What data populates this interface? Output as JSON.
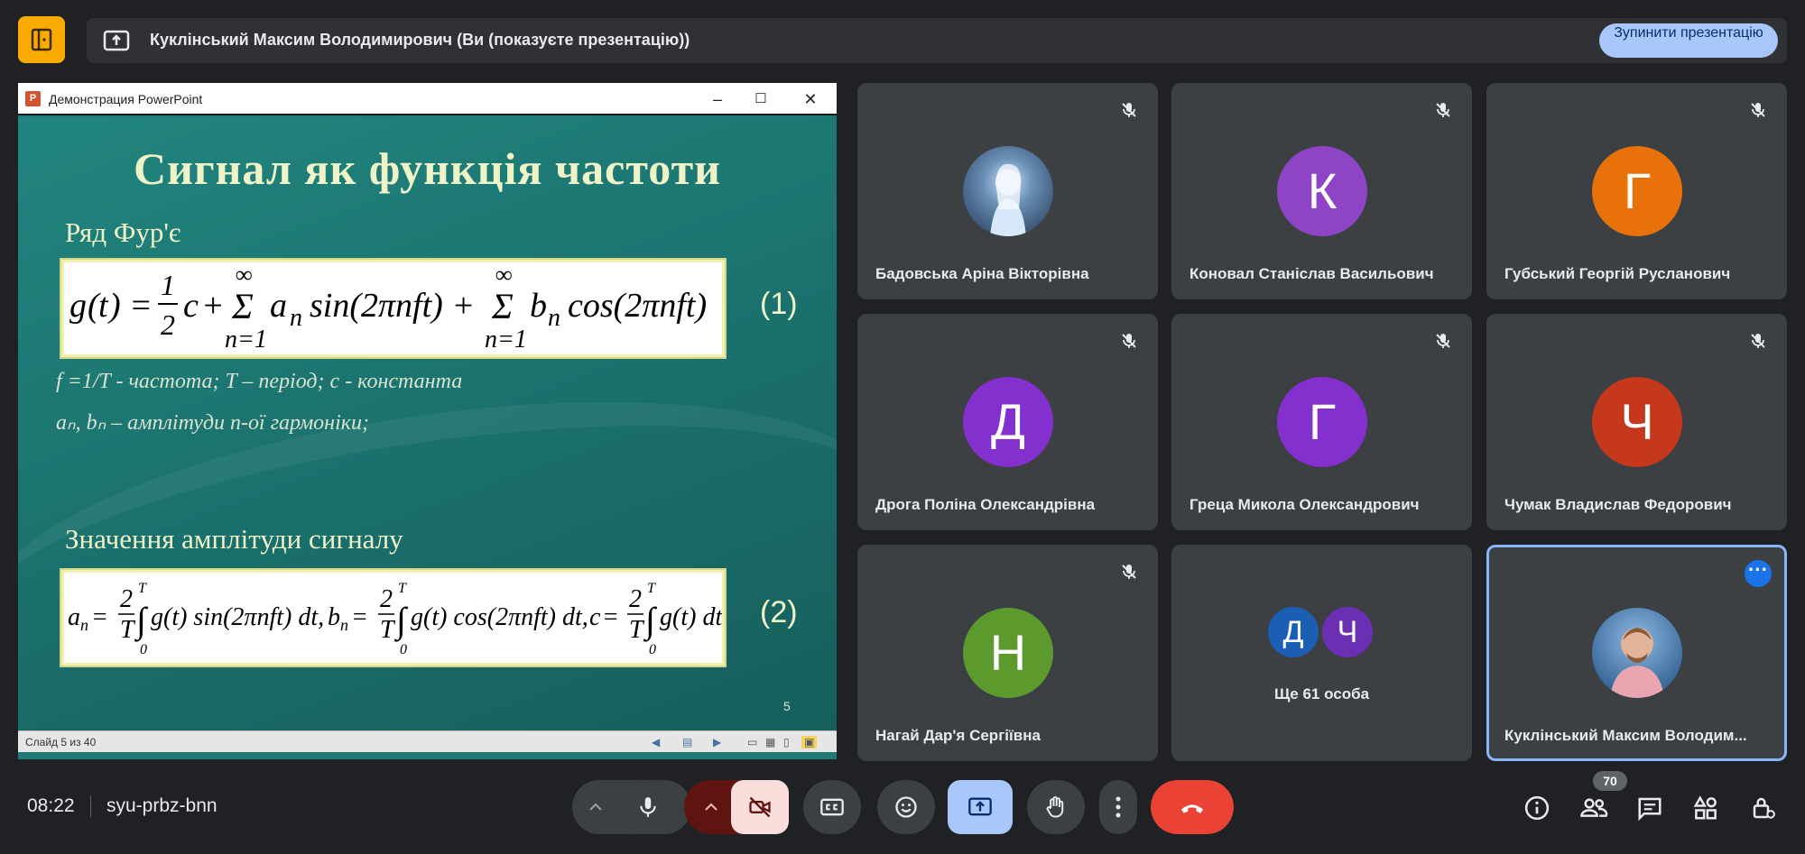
{
  "banner": {
    "presenter_text": "Куклінський Максим Володимирович (Ви (показуєте презентацію))",
    "stop_button": "Зупинити презентацію"
  },
  "ppt_window": {
    "title": "Демонстрация PowerPoint",
    "status": "Слайд 5 из 40"
  },
  "slide": {
    "title": "Сигнал як функція частоти",
    "subtitle1": "Ряд Фур'є",
    "eq1_number": "(1)",
    "note1": "f =1/T - частота;      T – період;      c - константа",
    "note2": "aₙ, bₙ – амплітуди n-ої гармоніки;",
    "subtitle2": "Значення амплітуди сигналу",
    "eq2_number": "(2)",
    "page_number": "5"
  },
  "participants": [
    {
      "name": "Бадовська Аріна Вікторівна",
      "avatar": "image",
      "color": "#3a5a7a",
      "muted": true
    },
    {
      "name": "Коновал Станіслав Васильович",
      "avatar": "К",
      "color": "#8e44c4",
      "muted": true
    },
    {
      "name": "Губський Георгій Русланович",
      "avatar": "Г",
      "color": "#e8710a",
      "muted": true
    },
    {
      "name": "Дрога Поліна Олександрівна",
      "avatar": "Д",
      "color": "#8430ce",
      "muted": true
    },
    {
      "name": "Греца Микола Олександрович",
      "avatar": "Г",
      "color": "#8430ce",
      "muted": true
    },
    {
      "name": "Чумак Владислав Федорович",
      "avatar": "Ч",
      "color": "#c5381c",
      "muted": true
    },
    {
      "name": "Нагай Дар'я Сергіївна",
      "avatar": "Н",
      "color": "#5c9a2e",
      "muted": true
    },
    {
      "name": "Ще 61 особа",
      "avatars": [
        "Д",
        "Ч"
      ],
      "colors": [
        "#1a5fb4",
        "#6b2fb3"
      ]
    },
    {
      "name": "Куклінський Максим Володим...",
      "avatar": "image",
      "color": "#4a7fb0",
      "active": true
    }
  ],
  "bottom": {
    "time": "08:22",
    "meeting_code": "syu-prbz-bnn",
    "people_count": "70"
  },
  "colors": {
    "background": "#202124",
    "tile": "#3c4043",
    "accent": "#a8c7fa",
    "end_call": "#ea4335"
  }
}
